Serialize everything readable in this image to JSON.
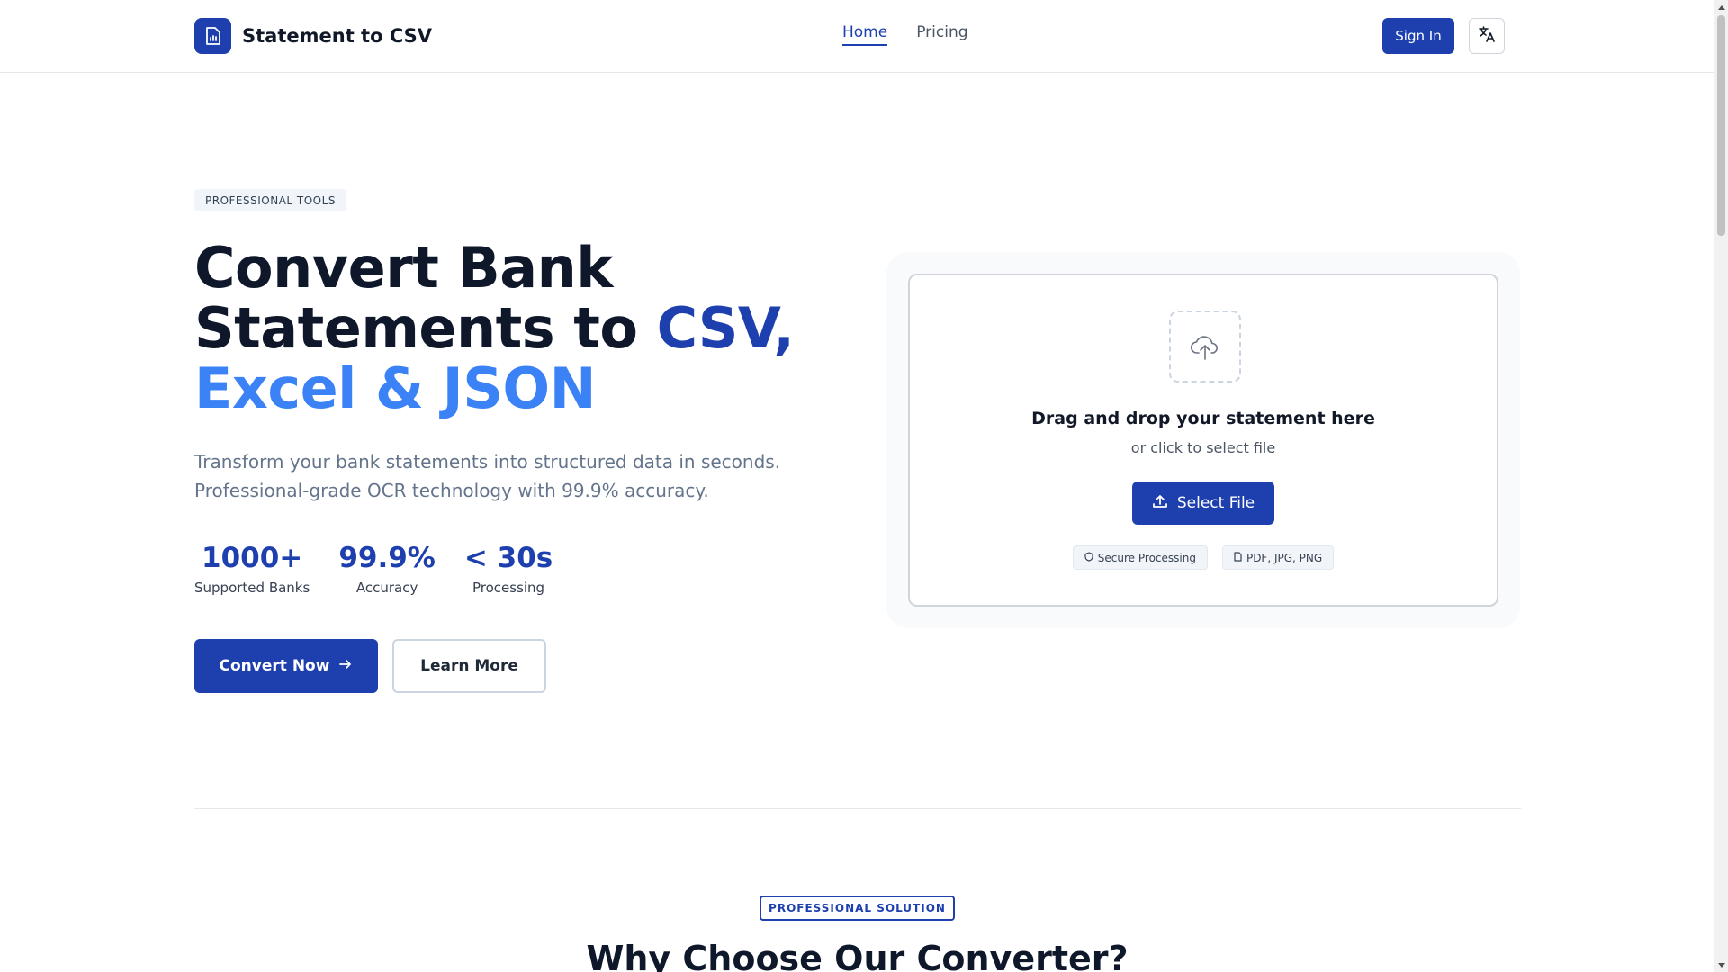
{
  "header": {
    "brand": "Statement to CSV",
    "nav": [
      {
        "label": "Home",
        "active": true
      },
      {
        "label": "Pricing",
        "active": false
      }
    ],
    "signin_label": "Sign In",
    "language_icon": "translate-icon",
    "logo_icon": "document-chart-icon"
  },
  "hero": {
    "tag": "PROFESSIONAL TOOLS",
    "title_line1": "Convert Bank",
    "title_line2_plain": "Statements to ",
    "title_line2_accent": "CSV,",
    "title_line3_accent": "Excel & JSON",
    "subtitle": "Transform your bank statements into structured data in seconds. Professional-grade OCR technology with 99.9% accuracy.",
    "stats": [
      {
        "value": "1000+",
        "label": "Supported Banks"
      },
      {
        "value": "99.9%",
        "label": "Accuracy"
      },
      {
        "value": "< 30s",
        "label": "Processing"
      }
    ],
    "primary_button": "Convert Now",
    "secondary_button": "Learn More"
  },
  "upload": {
    "title": "Drag and drop your statement here",
    "subtitle": "or click to select file",
    "button": "Select File",
    "chips": [
      {
        "icon": "shield-icon",
        "label": "Secure Processing"
      },
      {
        "icon": "file-icon",
        "label": "PDF, JPG, PNG"
      }
    ]
  },
  "section": {
    "tag": "PROFESSIONAL SOLUTION",
    "title": "Why Choose Our Converter?"
  },
  "colors": {
    "primary": "#1e40af",
    "accent": "#3b82f6",
    "text": "#0f172a",
    "muted": "#64748b"
  }
}
